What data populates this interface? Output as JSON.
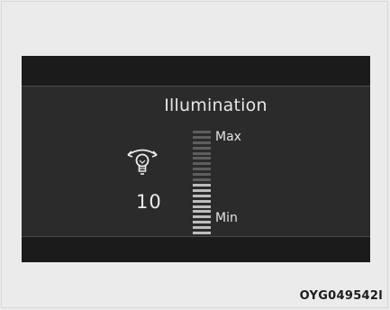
{
  "screen": {
    "title": "Illumination",
    "icon": "adjustable-light-bulb-icon",
    "level_value": "10",
    "max_label": "Max",
    "min_label": "Min",
    "scale": {
      "current_level": 10,
      "max_level": 20
    }
  },
  "figure_code": "OYG049542l",
  "colors": {
    "display_background": "#2b2b2b",
    "display_band": "#1b1b1b",
    "text": "#e6e6e6",
    "scale_on": "#bdbdbd",
    "scale_off": "#5e5e5e",
    "page_background": "#ebebeb"
  }
}
